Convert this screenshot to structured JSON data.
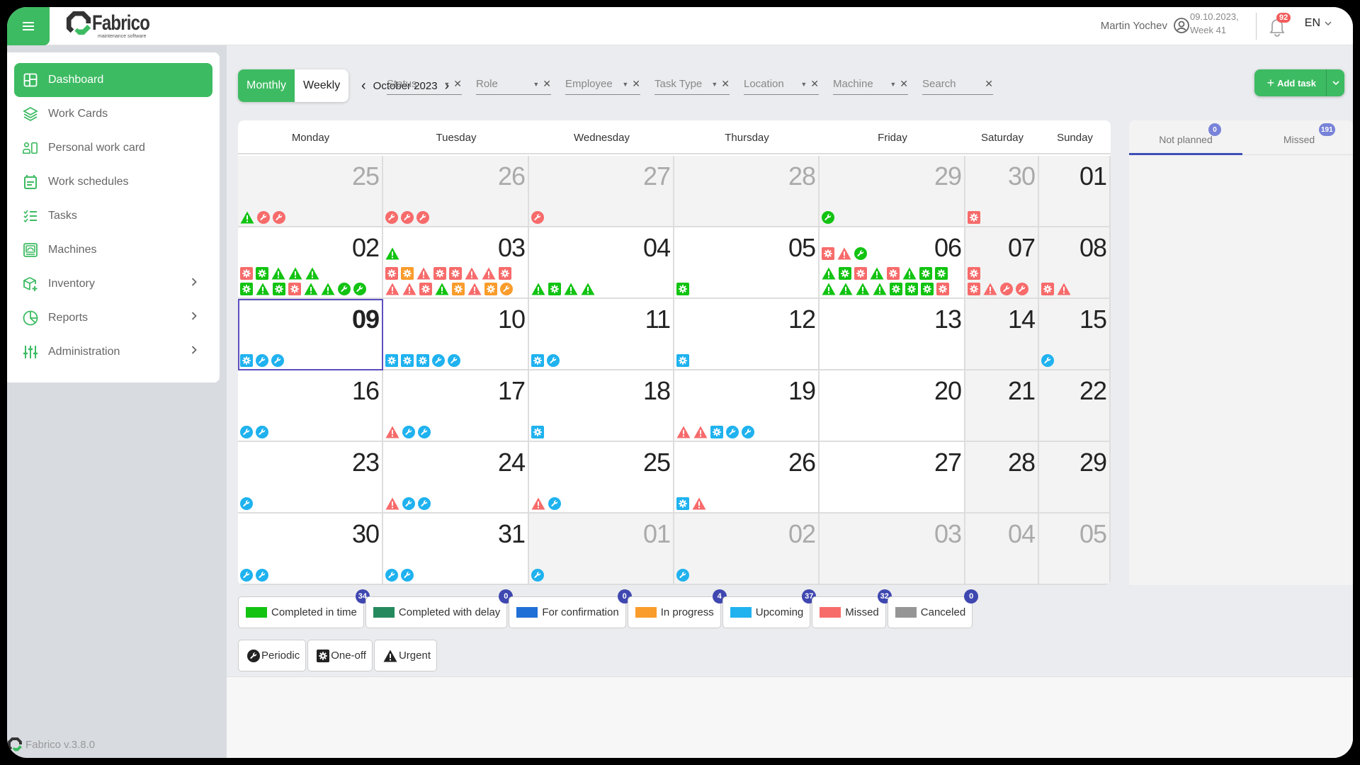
{
  "topbar": {
    "brand": "Fabrico",
    "tagline": "maintenance software",
    "user_name": "Martin Yochev",
    "date_line": "09.10.2023,",
    "week_line": "Week 41",
    "notification_count": "92",
    "language": "EN"
  },
  "sidebar": {
    "items": [
      {
        "label": "Dashboard",
        "icon": "dashboard-icon",
        "active": true,
        "expandable": false
      },
      {
        "label": "Work Cards",
        "icon": "layers-icon",
        "active": false,
        "expandable": false
      },
      {
        "label": "Personal work card",
        "icon": "personal-card-icon",
        "active": false,
        "expandable": false
      },
      {
        "label": "Work schedules",
        "icon": "calendar-icon",
        "active": false,
        "expandable": false
      },
      {
        "label": "Tasks",
        "icon": "checklist-icon",
        "active": false,
        "expandable": false
      },
      {
        "label": "Machines",
        "icon": "machine-icon",
        "active": false,
        "expandable": false
      },
      {
        "label": "Inventory",
        "icon": "package-icon",
        "active": false,
        "expandable": true
      },
      {
        "label": "Reports",
        "icon": "pie-chart-icon",
        "active": false,
        "expandable": true
      },
      {
        "label": "Administration",
        "icon": "sliders-icon",
        "active": false,
        "expandable": true
      }
    ],
    "version": "Fabrico v.3.8.0"
  },
  "toolbar": {
    "view_monthly": "Monthly",
    "view_weekly": "Weekly",
    "active_view": "Monthly",
    "current_month": "October 2023",
    "filters": [
      {
        "label": "Status",
        "dropdown": true
      },
      {
        "label": "Role",
        "dropdown": true
      },
      {
        "label": "Employee",
        "dropdown": true
      },
      {
        "label": "Task Type",
        "dropdown": true
      },
      {
        "label": "Location",
        "dropdown": true
      },
      {
        "label": "Machine",
        "dropdown": true
      },
      {
        "label": "Search",
        "dropdown": false
      }
    ],
    "add_task_label": "Add task"
  },
  "status_colors": {
    "completed_in_time": "#12c312",
    "completed_with_delay": "#248a5e",
    "for_confirmation": "#1f6fd6",
    "in_progress": "#fa9c2c",
    "upcoming": "#1fb2ef",
    "missed": "#f76b6b",
    "canceled": "#959595"
  },
  "calendar": {
    "weekdays": [
      "Monday",
      "Tuesday",
      "Wednesday",
      "Thursday",
      "Friday",
      "Saturday",
      "Sunday"
    ],
    "today": "09",
    "weeks": [
      [
        {
          "day": "25",
          "other": true,
          "top": [],
          "rows": [
            [
              [
                "U",
                "completed_in_time"
              ],
              [
                "P",
                "missed"
              ],
              [
                "P",
                "missed"
              ]
            ]
          ]
        },
        {
          "day": "26",
          "other": true,
          "top": [],
          "rows": [
            [
              [
                "P",
                "missed"
              ],
              [
                "P",
                "missed"
              ],
              [
                "P",
                "missed"
              ]
            ]
          ]
        },
        {
          "day": "27",
          "other": true,
          "top": [],
          "rows": [
            [
              [
                "P",
                "missed"
              ]
            ]
          ]
        },
        {
          "day": "28",
          "other": true,
          "top": [],
          "rows": []
        },
        {
          "day": "29",
          "other": true,
          "top": [],
          "rows": [
            [
              [
                "P",
                "completed_in_time"
              ]
            ]
          ]
        },
        {
          "day": "30",
          "other": true,
          "top": [],
          "rows": [
            [
              [
                "O",
                "missed"
              ]
            ]
          ]
        },
        {
          "day": "01",
          "other": false,
          "weekend": true,
          "top": [],
          "rows": []
        }
      ],
      [
        {
          "day": "02",
          "other": false,
          "top": [],
          "rows": [
            [
              [
                "O",
                "missed"
              ],
              [
                "O",
                "completed_in_time"
              ],
              [
                "U",
                "completed_in_time"
              ],
              [
                "U",
                "completed_in_time"
              ],
              [
                "U",
                "completed_in_time"
              ]
            ],
            [
              [
                "O",
                "completed_in_time"
              ],
              [
                "U",
                "completed_in_time"
              ],
              [
                "O",
                "completed_in_time"
              ],
              [
                "O",
                "missed"
              ],
              [
                "U",
                "completed_in_time"
              ],
              [
                "U",
                "completed_in_time"
              ],
              [
                "P",
                "completed_in_time"
              ],
              [
                "P",
                "completed_in_time"
              ]
            ]
          ]
        },
        {
          "day": "03",
          "other": false,
          "top": [
            [
              "U",
              "completed_in_time"
            ]
          ],
          "rows": [
            [
              [
                "O",
                "missed"
              ],
              [
                "O",
                "in_progress"
              ],
              [
                "U",
                "missed"
              ],
              [
                "O",
                "missed"
              ],
              [
                "O",
                "missed"
              ],
              [
                "U",
                "missed"
              ],
              [
                "U",
                "missed"
              ],
              [
                "O",
                "missed"
              ]
            ],
            [
              [
                "U",
                "missed"
              ],
              [
                "U",
                "missed"
              ],
              [
                "O",
                "missed"
              ],
              [
                "U",
                "completed_in_time"
              ],
              [
                "O",
                "in_progress"
              ],
              [
                "U",
                "missed"
              ],
              [
                "O",
                "in_progress"
              ],
              [
                "P",
                "in_progress"
              ]
            ]
          ]
        },
        {
          "day": "04",
          "other": false,
          "top": [],
          "rows": [
            [
              [
                "U",
                "completed_in_time"
              ],
              [
                "O",
                "completed_in_time"
              ],
              [
                "U",
                "completed_in_time"
              ],
              [
                "U",
                "completed_in_time"
              ]
            ]
          ]
        },
        {
          "day": "05",
          "other": false,
          "top": [],
          "rows": [
            [
              [
                "O",
                "completed_in_time"
              ]
            ]
          ]
        },
        {
          "day": "06",
          "other": false,
          "top": [
            [
              "O",
              "missed"
            ],
            [
              "U",
              "missed"
            ],
            [
              "P",
              "completed_in_time"
            ]
          ],
          "rows": [
            [
              [
                "U",
                "completed_in_time"
              ],
              [
                "O",
                "completed_in_time"
              ],
              [
                "O",
                "missed"
              ],
              [
                "U",
                "completed_in_time"
              ],
              [
                "O",
                "missed"
              ],
              [
                "U",
                "completed_in_time"
              ],
              [
                "O",
                "completed_in_time"
              ],
              [
                "O",
                "completed_in_time"
              ]
            ],
            [
              [
                "U",
                "completed_in_time"
              ],
              [
                "U",
                "completed_in_time"
              ],
              [
                "U",
                "completed_in_time"
              ],
              [
                "U",
                "completed_in_time"
              ],
              [
                "O",
                "completed_in_time"
              ],
              [
                "O",
                "completed_in_time"
              ],
              [
                "O",
                "completed_in_time"
              ],
              [
                "O",
                "missed"
              ]
            ]
          ]
        },
        {
          "day": "07",
          "other": false,
          "weekend": true,
          "top": [],
          "rows": [
            [
              [
                "O",
                "missed"
              ]
            ],
            [
              [
                "O",
                "missed"
              ],
              [
                "U",
                "missed"
              ],
              [
                "P",
                "missed"
              ],
              [
                "P",
                "missed"
              ]
            ]
          ]
        },
        {
          "day": "08",
          "other": false,
          "weekend": true,
          "top": [],
          "rows": [
            [
              [
                "O",
                "missed"
              ],
              [
                "U",
                "missed"
              ]
            ]
          ]
        }
      ],
      [
        {
          "day": "09",
          "other": false,
          "today": true,
          "top": [],
          "rows": [
            [
              [
                "O",
                "upcoming"
              ],
              [
                "P",
                "upcoming"
              ],
              [
                "P",
                "upcoming"
              ]
            ]
          ]
        },
        {
          "day": "10",
          "other": false,
          "top": [],
          "rows": [
            [
              [
                "O",
                "upcoming"
              ],
              [
                "O",
                "upcoming"
              ],
              [
                "O",
                "upcoming"
              ],
              [
                "P",
                "upcoming"
              ],
              [
                "P",
                "upcoming"
              ]
            ]
          ]
        },
        {
          "day": "11",
          "other": false,
          "top": [],
          "rows": [
            [
              [
                "O",
                "upcoming"
              ],
              [
                "P",
                "upcoming"
              ]
            ]
          ]
        },
        {
          "day": "12",
          "other": false,
          "top": [],
          "rows": [
            [
              [
                "O",
                "upcoming"
              ]
            ]
          ]
        },
        {
          "day": "13",
          "other": false,
          "top": [],
          "rows": []
        },
        {
          "day": "14",
          "other": false,
          "weekend": true,
          "top": [],
          "rows": []
        },
        {
          "day": "15",
          "other": false,
          "weekend": true,
          "top": [],
          "rows": [
            [
              [
                "P",
                "upcoming"
              ]
            ]
          ]
        }
      ],
      [
        {
          "day": "16",
          "other": false,
          "top": [],
          "rows": [
            [
              [
                "P",
                "upcoming"
              ],
              [
                "P",
                "upcoming"
              ]
            ]
          ]
        },
        {
          "day": "17",
          "other": false,
          "top": [],
          "rows": [
            [
              [
                "U",
                "missed"
              ],
              [
                "P",
                "upcoming"
              ],
              [
                "P",
                "upcoming"
              ]
            ]
          ]
        },
        {
          "day": "18",
          "other": false,
          "top": [],
          "rows": [
            [
              [
                "O",
                "upcoming"
              ]
            ]
          ]
        },
        {
          "day": "19",
          "other": false,
          "top": [],
          "rows": [
            [
              [
                "U",
                "missed"
              ],
              [
                "U",
                "missed"
              ],
              [
                "O",
                "upcoming"
              ],
              [
                "P",
                "upcoming"
              ],
              [
                "P",
                "upcoming"
              ]
            ]
          ]
        },
        {
          "day": "20",
          "other": false,
          "top": [],
          "rows": []
        },
        {
          "day": "21",
          "other": false,
          "weekend": true,
          "top": [],
          "rows": []
        },
        {
          "day": "22",
          "other": false,
          "weekend": true,
          "top": [],
          "rows": []
        }
      ],
      [
        {
          "day": "23",
          "other": false,
          "top": [],
          "rows": [
            [
              [
                "P",
                "upcoming"
              ]
            ]
          ]
        },
        {
          "day": "24",
          "other": false,
          "top": [],
          "rows": [
            [
              [
                "U",
                "missed"
              ],
              [
                "P",
                "upcoming"
              ],
              [
                "P",
                "upcoming"
              ]
            ]
          ]
        },
        {
          "day": "25",
          "other": false,
          "top": [],
          "rows": [
            [
              [
                "U",
                "missed"
              ],
              [
                "P",
                "upcoming"
              ]
            ]
          ]
        },
        {
          "day": "26",
          "other": false,
          "top": [],
          "rows": [
            [
              [
                "O",
                "upcoming"
              ],
              [
                "U",
                "missed"
              ]
            ]
          ]
        },
        {
          "day": "27",
          "other": false,
          "top": [],
          "rows": []
        },
        {
          "day": "28",
          "other": false,
          "weekend": true,
          "top": [],
          "rows": []
        },
        {
          "day": "29",
          "other": false,
          "weekend": true,
          "top": [],
          "rows": []
        }
      ],
      [
        {
          "day": "30",
          "other": false,
          "top": [],
          "rows": [
            [
              [
                "P",
                "upcoming"
              ],
              [
                "P",
                "upcoming"
              ]
            ]
          ]
        },
        {
          "day": "31",
          "other": false,
          "top": [],
          "rows": [
            [
              [
                "P",
                "upcoming"
              ],
              [
                "P",
                "upcoming"
              ]
            ]
          ]
        },
        {
          "day": "01",
          "other": true,
          "top": [],
          "rows": [
            [
              [
                "P",
                "upcoming"
              ]
            ]
          ]
        },
        {
          "day": "02",
          "other": true,
          "top": [],
          "rows": [
            [
              [
                "P",
                "upcoming"
              ]
            ]
          ]
        },
        {
          "day": "03",
          "other": true,
          "top": [],
          "rows": []
        },
        {
          "day": "04",
          "other": true,
          "top": [],
          "rows": []
        },
        {
          "day": "05",
          "other": true,
          "top": [],
          "rows": []
        }
      ]
    ]
  },
  "side_panel": {
    "tabs": [
      {
        "label": "Not planned",
        "count": "0",
        "active": true
      },
      {
        "label": "Missed",
        "count": "191",
        "active": false
      }
    ]
  },
  "legend": {
    "statuses": [
      {
        "label": "Completed in time",
        "key": "completed_in_time",
        "count": "34"
      },
      {
        "label": "Completed with delay",
        "key": "completed_with_delay",
        "count": "0"
      },
      {
        "label": "For confirmation",
        "key": "for_confirmation",
        "count": "0"
      },
      {
        "label": "In progress",
        "key": "in_progress",
        "count": "4"
      },
      {
        "label": "Upcoming",
        "key": "upcoming",
        "count": "37"
      },
      {
        "label": "Missed",
        "key": "missed",
        "count": "32"
      },
      {
        "label": "Canceled",
        "key": "canceled",
        "count": "0"
      }
    ],
    "types": [
      {
        "label": "Periodic",
        "icon": "wrench-icon",
        "code": "P"
      },
      {
        "label": "One-off",
        "icon": "gear-icon",
        "code": "O"
      },
      {
        "label": "Urgent",
        "icon": "warning-icon",
        "code": "U"
      }
    ]
  }
}
